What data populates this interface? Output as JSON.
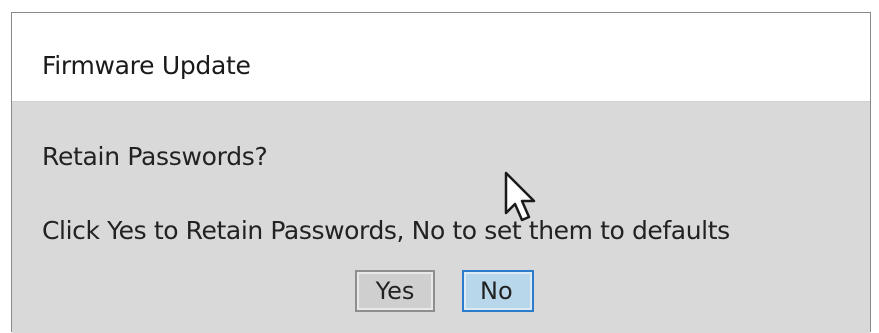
{
  "window": {
    "title": "Firmware Update"
  },
  "dialog": {
    "question": "Retain Passwords?",
    "message": "Click Yes to Retain Passwords, No to set them to defaults"
  },
  "buttons": {
    "yes_label": "Yes",
    "no_label": "No"
  },
  "colors": {
    "dialog_background": "#d9d9d9",
    "title_background": "#ffffff",
    "focused_button_border": "#2c7ccc",
    "focused_button_fill": "#b9d7ea"
  },
  "icons": {
    "cursor": "mouse-pointer-icon"
  }
}
